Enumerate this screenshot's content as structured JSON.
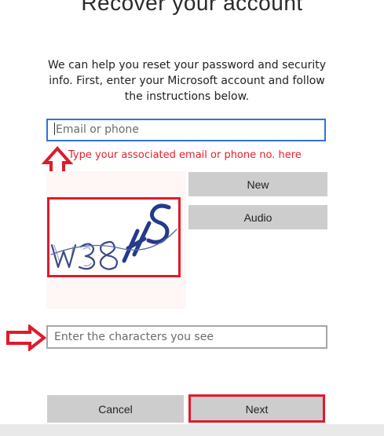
{
  "page": {
    "title": "Recover your account",
    "description": "We can help you reset your password and security info. First, enter your Microsoft account and follow the instructions below."
  },
  "email": {
    "placeholder": "Email or phone",
    "value": ""
  },
  "annotation": {
    "hint": "Type your associated email or phone no. here",
    "highlight_color": "#e01a2b"
  },
  "captcha": {
    "text": "W38HS",
    "new_label": "New",
    "audio_label": "Audio"
  },
  "characters": {
    "placeholder": "Enter the characters you see",
    "value": ""
  },
  "actions": {
    "cancel_label": "Cancel",
    "next_label": "Next"
  },
  "colors": {
    "accent": "#2d74d6",
    "button_gray": "#cdcdcd",
    "hint_red": "#e5202e"
  }
}
